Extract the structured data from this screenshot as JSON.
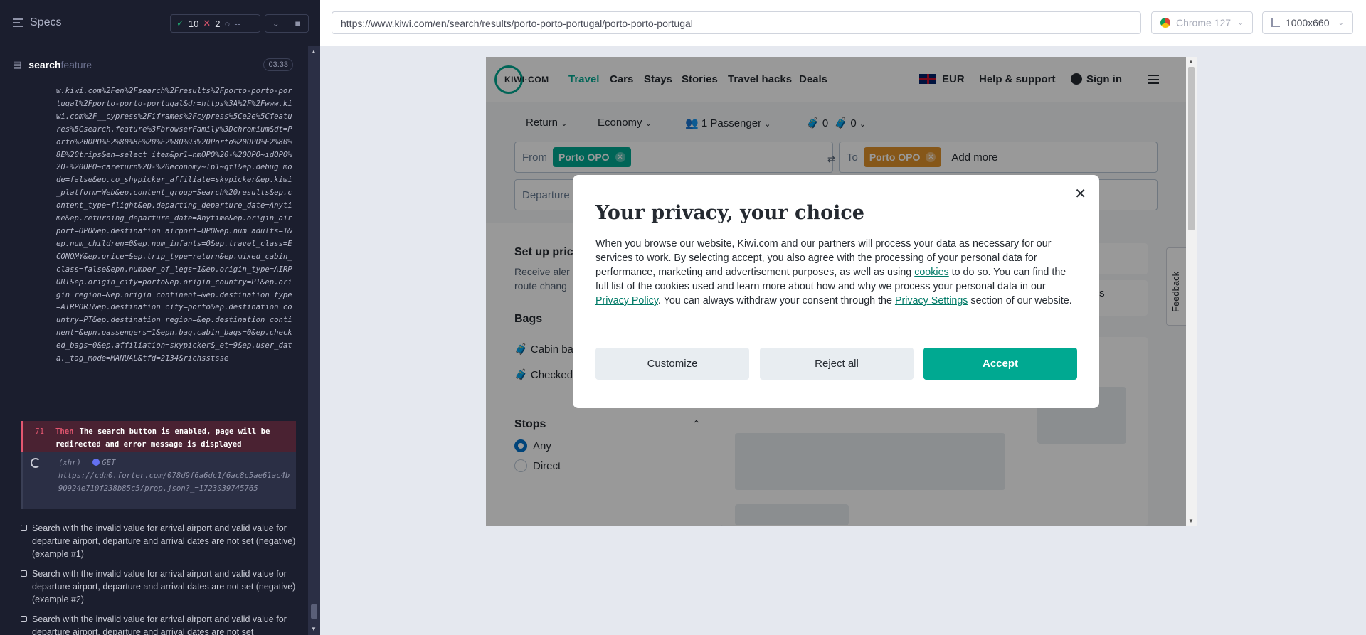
{
  "reporter": {
    "title": "Specs",
    "passed": "10",
    "failed": "2",
    "pending": "--",
    "file_name": "search",
    "file_ext": "feature",
    "duration": "03:33",
    "url_log": "w.kiwi.com%2Fen%2Fsearch%2Fresults%2Fporto-porto-portugal%2Fporto-porto-portugal&dr=https%3A%2F%2Fwww.kiwi.com%2F__cypress%2Fiframes%2Fcypress%5Ce2e%5Cfeatures%5Csearch.feature%3FbrowserFamily%3Dchromium&dt=Porto%20OPO%E2%80%8E%20%E2%80%93%20Porto%20OPO%E2%80%8E%20trips&en=select_item&pr1=nmOPO%20-%20OPO~idOPO%20-%20OPO~careturn%20-%20economy~lp1~qt1&ep.debug_mode=false&ep.co_shypicker_affiliate=skypicker&ep.kiwi_platform=Web&ep.content_group=Search%20results&ep.content_type=flight&ep.departing_departure_date=Anytime&ep.returning_departure_date=Anytime&ep.origin_airport=OPO&ep.destination_airport=OPO&ep.num_adults=1&ep.num_children=0&ep.num_infants=0&ep.travel_class=ECONOMY&ep.price=&ep.trip_type=return&ep.mixed_cabin_class=false&epn.number_of_legs=1&ep.origin_type=AIRPORT&ep.origin_city=porto&ep.origin_country=PT&ep.origin_region=&ep.origin_continent=&ep.destination_type=AIRPORT&ep.destination_city=porto&ep.destination_country=PT&ep.destination_region=&ep.destination_continent=&epn.passengers=1&epn.bag.cabin_bags=0&ep.checked_bags=0&ep.affiliation=skypicker&_et=9&ep.user_data._tag_mode=MANUAL&tfd=2134&richsstsse",
    "then_num": "71",
    "then_kw": "Then",
    "then_text": "The search button is enabled, page will be redirected and error message is displayed",
    "xhr_label": "(xhr)",
    "xhr_method": "GET",
    "xhr_url": "https://cdn0.forter.com/078d9f6a6dc1/6ac8c5ae61ac4b90924e710f238b85c5/prop.json?_=1723039745765",
    "tests": [
      "Search with the invalid value for arrival airport and valid value for departure airport, departure and arrival dates are not set (negative) (example #1)",
      "Search with the invalid value for arrival airport and valid value for departure airport, departure and arrival dates are not set (negative) (example #2)",
      "Search with the invalid value for arrival airport and valid value for departure airport, departure and arrival dates are not set"
    ]
  },
  "aut": {
    "url": "https://www.kiwi.com/en/search/results/porto-porto-portugal/porto-porto-portugal",
    "browser": "Chrome 127",
    "viewport": "1000x660"
  },
  "kiwi": {
    "logo": "KIWI·COM",
    "nav": [
      "Travel",
      "Cars",
      "Stays",
      "Stories",
      "Travel hacks",
      "Deals"
    ],
    "currency": "EUR",
    "help": "Help & support",
    "sign_in": "Sign in",
    "trip_type": "Return",
    "cabin": "Economy",
    "passengers": "1 Passenger",
    "cabin_bags": "0",
    "checked_bags": "0",
    "from_label": "From",
    "from_chip": "Porto OPO",
    "to_label": "To",
    "to_chip": "Porto OPO",
    "add_more": "Add more",
    "departure": "Departure",
    "price_alert_title": "Set up pric",
    "price_alert_text": "Receive aler",
    "price_alert_text2": "route chang",
    "bags_title": "Bags",
    "cabin_bag": "Cabin ba",
    "checked_baggage": "Checked baggage",
    "stops_title": "Stops",
    "stop_any": "Any",
    "stop_direct": "Direct",
    "options_fragment": "tions",
    "feedback": "Feedback",
    "colors": {
      "brand": "#00a991",
      "from_chip": "#00a991",
      "to_chip": "#e0912b"
    }
  },
  "modal": {
    "title": "Your privacy, your choice",
    "body_1": "When you browse our website, Kiwi.com and our partners will process your data as necessary for our services to work. By selecting accept, you also agree with the processing of your personal data for performance, marketing and advertisement purposes, as well as using ",
    "cookies_link": "cookies",
    "body_2": " to do so. You can find the full list of the cookies used and learn more about how and why we process your personal data in our ",
    "privacy_link": "Privacy Policy",
    "body_3": ". You can always withdraw your consent through the ",
    "settings_link": "Privacy Settings",
    "body_4": " section of our website.",
    "customize": "Customize",
    "reject": "Reject all",
    "accept": "Accept"
  }
}
